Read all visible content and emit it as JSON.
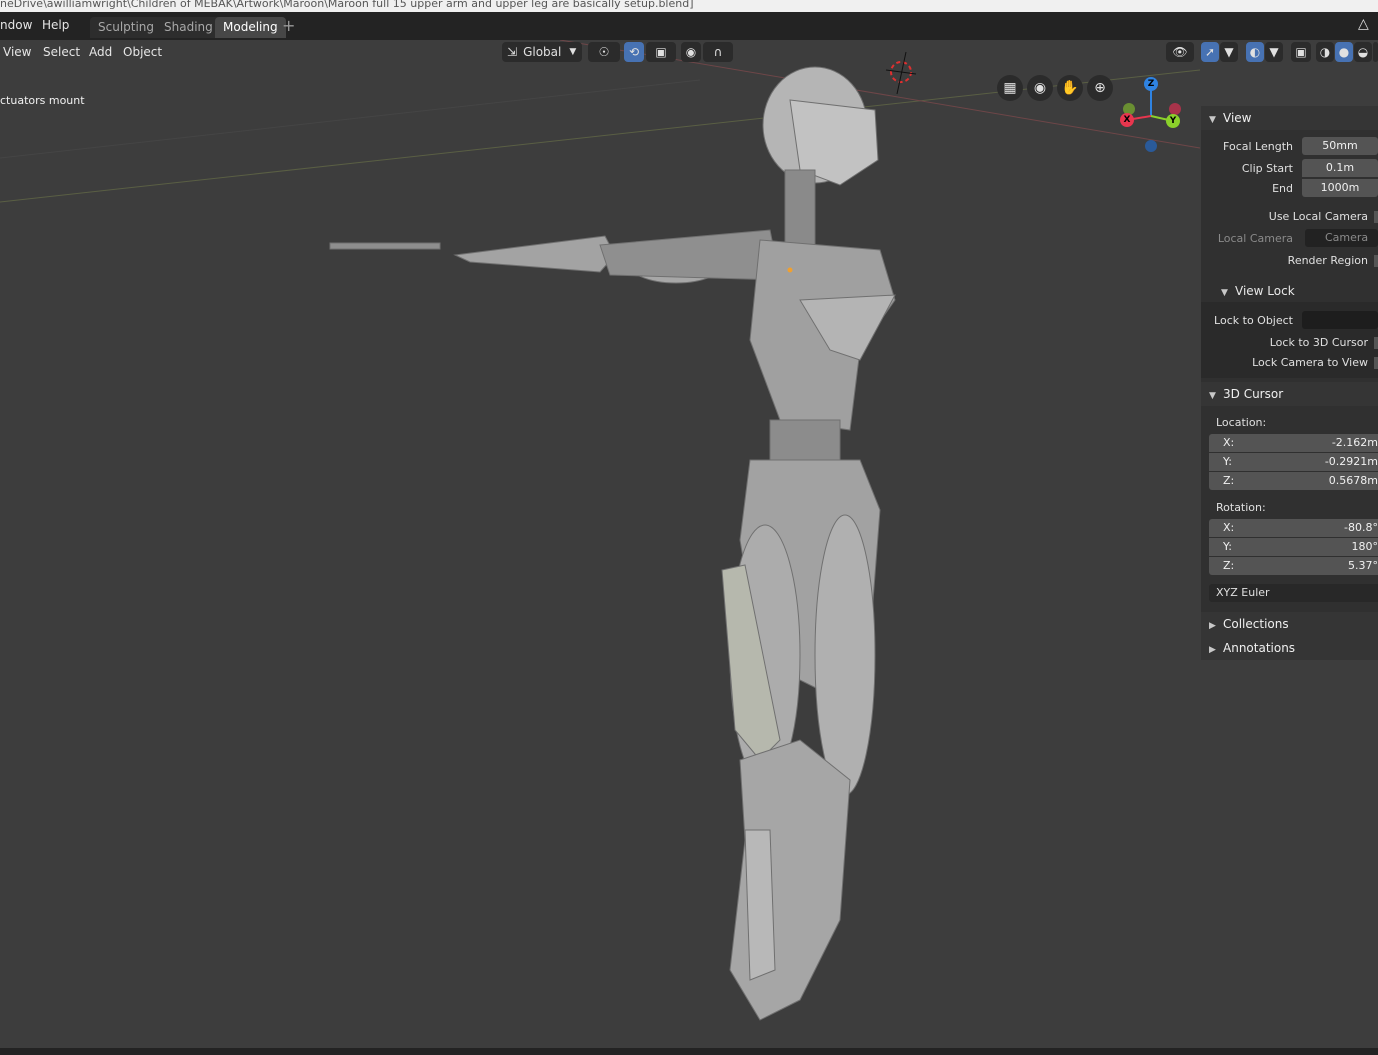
{
  "window": {
    "title": "neDrive\\awilliamwright\\Children of MEBAK\\Artwork\\Maroon\\Maroon full 15 upper arm and upper leg are basically setup.blend]"
  },
  "topbar": {
    "menus": [
      "ndow",
      "Help"
    ],
    "workspaces": [
      {
        "label": "Sculpting",
        "active": false
      },
      {
        "label": "Shading",
        "active": false
      },
      {
        "label": "Modeling",
        "active": true
      }
    ],
    "add_tab": "+"
  },
  "viewport_header": {
    "menus": [
      "View",
      "Select",
      "Add",
      "Object"
    ],
    "transform_orientation": "Global"
  },
  "viewport": {
    "active_object_label": "ctuators mount",
    "gizmo": {
      "x": "X",
      "y": "Y",
      "z": "Z"
    },
    "nav_icons": [
      "grid-view-icon",
      "camera-icon",
      "hand-pan-icon",
      "zoom-icon"
    ]
  },
  "npanel": {
    "view": {
      "header": "View",
      "focal_length_label": "Focal Length",
      "focal_length": "50mm",
      "clip_start_label": "Clip Start",
      "clip_start": "0.1m",
      "clip_end_label": "End",
      "clip_end": "1000m",
      "use_local_camera": "Use Local Camera",
      "local_camera_label": "Local Camera",
      "local_camera_placeholder": "Camera",
      "render_region": "Render Region"
    },
    "view_lock": {
      "header": "View Lock",
      "lock_to_object": "Lock to Object",
      "lock_to_3d_cursor": "Lock to 3D Cursor",
      "lock_camera_to_view": "Lock Camera to View"
    },
    "cursor": {
      "header": "3D Cursor",
      "location_label": "Location:",
      "location": [
        {
          "axis": "X:",
          "value": "-2.162m"
        },
        {
          "axis": "Y:",
          "value": "-0.2921m"
        },
        {
          "axis": "Z:",
          "value": "0.5678m"
        }
      ],
      "rotation_label": "Rotation:",
      "rotation": [
        {
          "axis": "X:",
          "value": "-80.8°"
        },
        {
          "axis": "Y:",
          "value": "180°"
        },
        {
          "axis": "Z:",
          "value": "5.37°"
        }
      ],
      "rotation_mode": "XYZ Euler"
    },
    "collections": "Collections",
    "annotations": "Annotations"
  },
  "colors": {
    "viewport_bg": "#3d3d3d",
    "accent": "#4772b3",
    "axis_x": "#e8364e",
    "axis_y": "#8bd12b",
    "axis_z": "#2f83e2"
  }
}
